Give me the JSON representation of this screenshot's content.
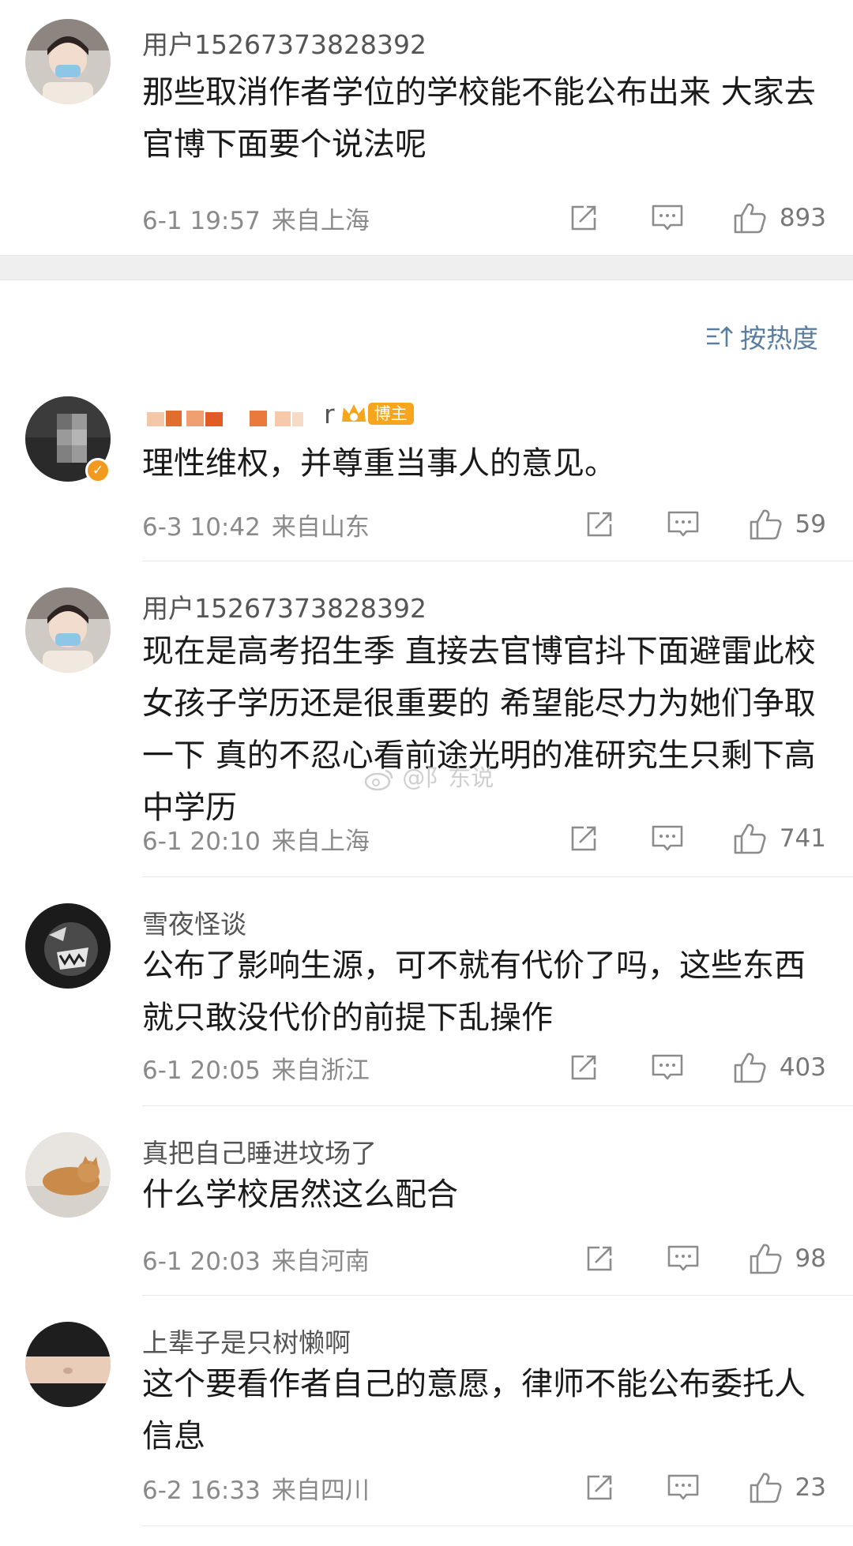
{
  "sort_label": "按热度",
  "blogger_badge": "博主",
  "watermark": "@阝东说",
  "colors": {
    "link_blue": "#5a7da0",
    "badge_orange": "#f7a51c",
    "meta_gray": "#8a8a8a"
  },
  "comments": [
    {
      "user": "用户15267373828392",
      "text": "那些取消作者学位的学校能不能公布出来 大家去官博下面要个说法呢",
      "time": "6-1 19:57",
      "location": "来自上海",
      "likes": "893"
    },
    {
      "user": "r",
      "text": "理性维权，并尊重当事人的意见。",
      "time": "6-3 10:42",
      "location": "来自山东",
      "likes": "59"
    },
    {
      "user": "用户15267373828392",
      "text": "现在是高考招生季 直接去官博官抖下面避雷此校 女孩子学历还是很重要的 希望能尽力为她们争取一下 真的不忍心看前途光明的准研究生只剩下高中学历",
      "time": "6-1 20:10",
      "location": "来自上海",
      "likes": "741"
    },
    {
      "user": "雪夜怪谈",
      "text": "公布了影响生源，可不就有代价了吗，这些东西就只敢没代价的前提下乱操作",
      "time": "6-1 20:05",
      "location": "来自浙江",
      "likes": "403"
    },
    {
      "user": "真把自己睡进坟场了",
      "text": "什么学校居然这么配合",
      "time": "6-1 20:03",
      "location": "来自河南",
      "likes": "98"
    },
    {
      "user": "上辈子是只树懒啊",
      "text": "这个要看作者自己的意愿，律师不能公布委托人信息",
      "time": "6-2 16:33",
      "location": "来自四川",
      "likes": "23"
    }
  ]
}
